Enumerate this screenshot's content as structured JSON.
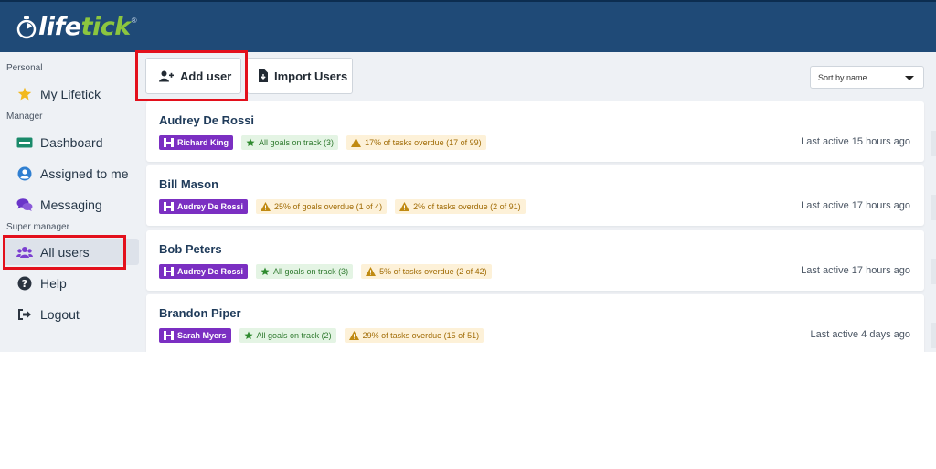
{
  "brand": {
    "logo_text_a": "life",
    "logo_text_b": "tick",
    "registered": "®"
  },
  "sidebar": {
    "sections": {
      "personal": "Personal",
      "manager": "Manager",
      "super_manager": "Super manager"
    },
    "items": [
      {
        "label": "My Lifetick",
        "icon": "star-icon"
      },
      {
        "label": "Dashboard",
        "icon": "dashboard-icon"
      },
      {
        "label": "Assigned to me",
        "icon": "user-circle-icon"
      },
      {
        "label": "Messaging",
        "icon": "chat-icon"
      },
      {
        "label": "All users",
        "icon": "users-icon",
        "active": true
      },
      {
        "label": "Help",
        "icon": "question-icon"
      },
      {
        "label": "Logout",
        "icon": "logout-icon"
      }
    ]
  },
  "toolbar": {
    "add_user": "Add user",
    "import_users": "Import Users",
    "sort": "Sort by name"
  },
  "users": [
    {
      "name": "Audrey De Rossi",
      "manager": "Richard King",
      "goals": {
        "type": "ok",
        "text": "All goals on track (3)"
      },
      "tasks": {
        "type": "warn",
        "text": "17% of tasks overdue (17 of 99)"
      },
      "last_active": "Last active 15 hours ago"
    },
    {
      "name": "Bill Mason",
      "manager": "Audrey De Rossi",
      "goals": {
        "type": "warn",
        "text": "25% of goals overdue (1 of 4)"
      },
      "tasks": {
        "type": "warn",
        "text": "2% of tasks overdue (2 of 91)"
      },
      "last_active": "Last active 17 hours ago"
    },
    {
      "name": "Bob Peters",
      "manager": "Audrey De Rossi",
      "goals": {
        "type": "ok",
        "text": "All goals on track (3)"
      },
      "tasks": {
        "type": "warn",
        "text": "5% of tasks overdue (2 of 42)"
      },
      "last_active": "Last active 17 hours ago"
    },
    {
      "name": "Brandon Piper",
      "manager": "Sarah Myers",
      "goals": {
        "type": "ok",
        "text": "All goals on track (2)"
      },
      "tasks": {
        "type": "warn",
        "text": "29% of tasks overdue (15 of 51)"
      },
      "last_active": "Last active 4 days ago"
    }
  ],
  "colors": {
    "header": "#1f4a77",
    "accent_green": "#8cc63f",
    "manager_tag": "#7b2fc2",
    "highlight": "#e3101c"
  }
}
